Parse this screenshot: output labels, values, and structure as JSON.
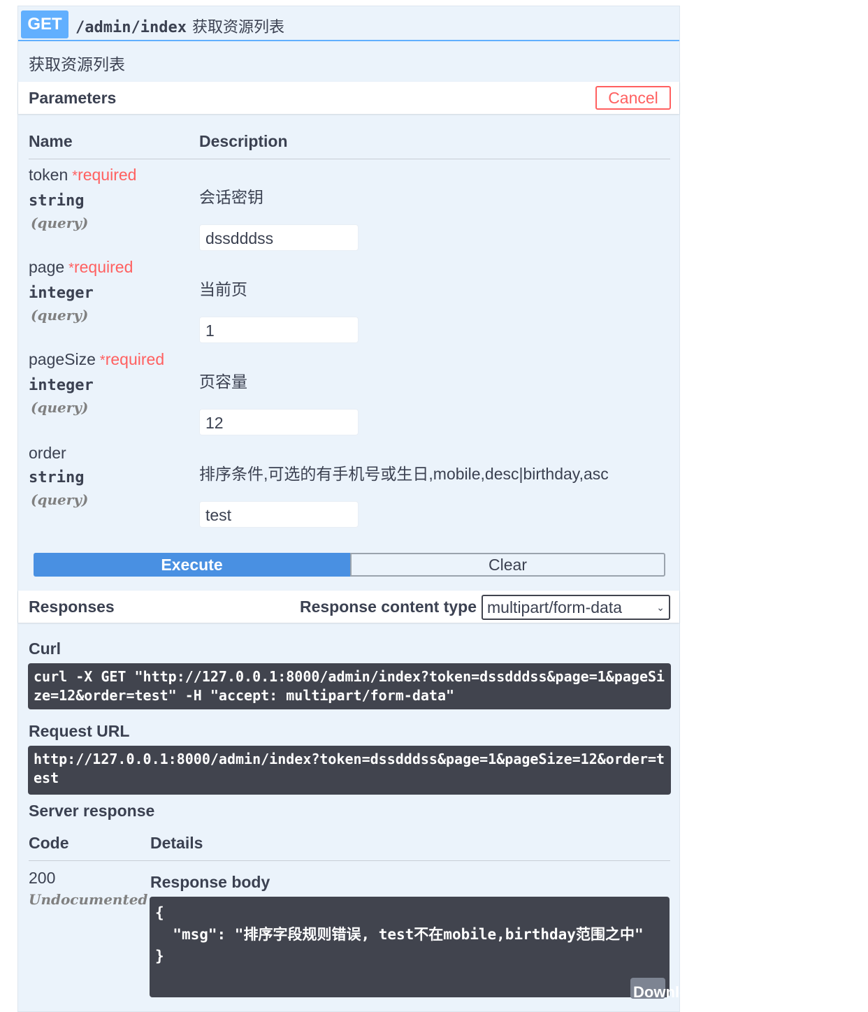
{
  "op": {
    "method": "GET",
    "path": "/admin/index",
    "summary": "获取资源列表",
    "description": "获取资源列表"
  },
  "parameters": {
    "title": "Parameters",
    "cancel_label": "Cancel",
    "col_name": "Name",
    "col_description": "Description",
    "required_label": "required",
    "required_star": "*",
    "items": [
      {
        "name": "token",
        "type": "string",
        "in": "(query)",
        "description": "会话密钥",
        "value": "dssdddss"
      },
      {
        "name": "page",
        "type": "integer",
        "in": "(query)",
        "description": "当前页",
        "value": "1"
      },
      {
        "name": "pageSize",
        "type": "integer",
        "in": "(query)",
        "description": "页容量",
        "value": "12"
      },
      {
        "name": "order",
        "type": "string",
        "in": "(query)",
        "description": "排序条件,可选的有手机号或生日,mobile,desc|birthday,asc",
        "value": "test"
      }
    ]
  },
  "actions": {
    "execute_label": "Execute",
    "clear_label": "Clear"
  },
  "responses": {
    "title": "Responses",
    "content_type_label": "Response content type",
    "content_type_value": "multipart/form-data",
    "curl_label": "Curl",
    "curl_text": "curl -X GET \"http://127.0.0.1:8000/admin/index?token=dssdddss&page=1&pageSize=12&order=test\" -H \"accept: multipart/form-data\"",
    "request_url_label": "Request URL",
    "request_url": "http://127.0.0.1:8000/admin/index?token=dssdddss&page=1&pageSize=12&order=test",
    "server_response_label": "Server response",
    "col_code": "Code",
    "col_details": "Details",
    "code": "200",
    "code_status": "Undocumented",
    "body_label": "Response body",
    "body_text": "{\n  \"msg\": \"排序字段规则错误, test不在mobile,birthday范围之中\"\n}",
    "download_label": "Download"
  },
  "colors": {
    "get": "#61affe",
    "execute": "#4990e2",
    "cancel": "#ff6060",
    "required": "#ff6060",
    "code_bg": "#41444e"
  }
}
